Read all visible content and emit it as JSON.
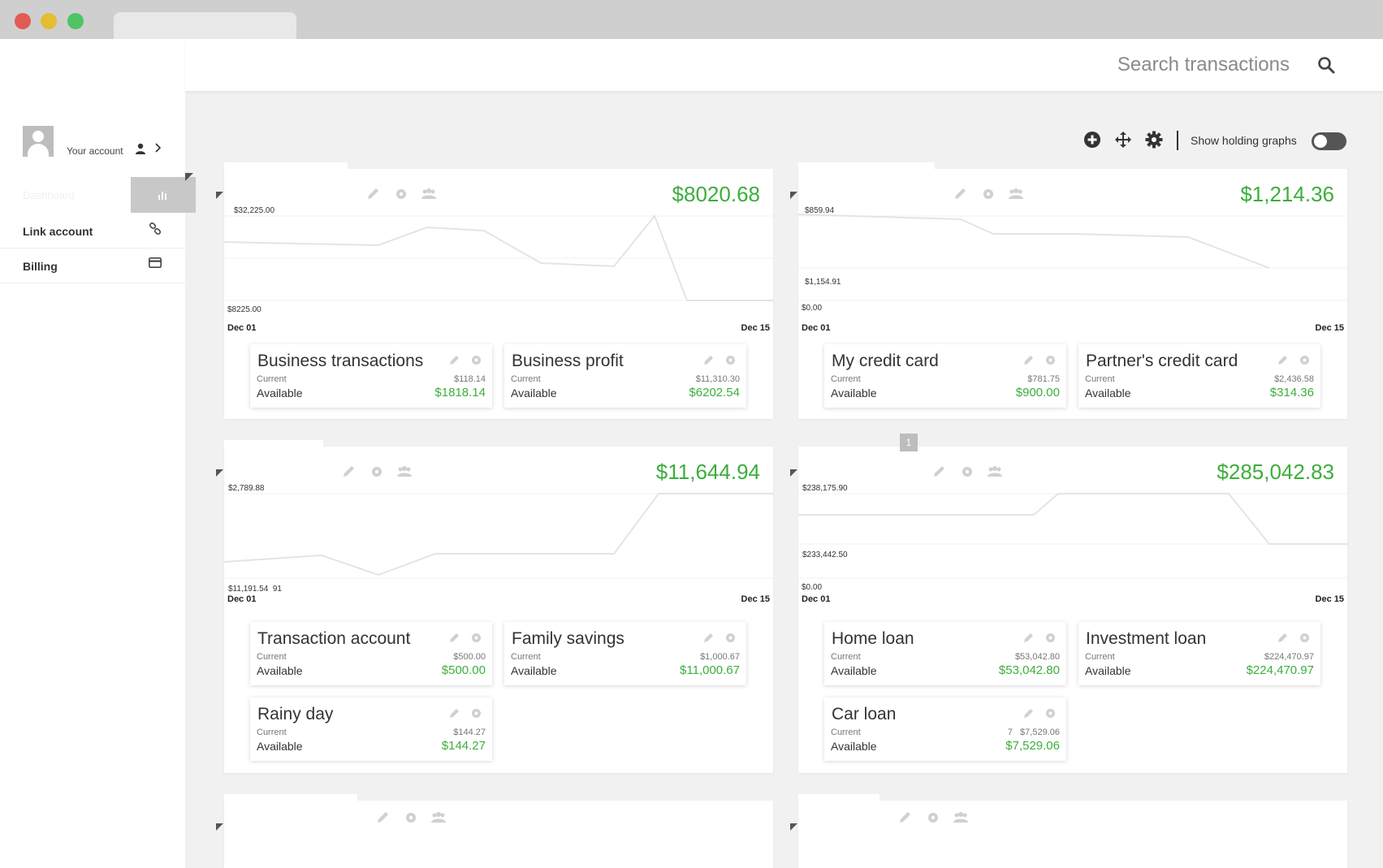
{
  "sidebar": {
    "account_label": "Your account",
    "dashboard_label": "Dashboard",
    "items": [
      {
        "label": "Link account",
        "icon": "link-icon"
      },
      {
        "label": "Billing",
        "icon": "credit-card-icon"
      }
    ]
  },
  "search": {
    "placeholder": "Search transactions"
  },
  "toolbar": {
    "toggle_label": "Show holding graphs",
    "toggle_on": false
  },
  "colors": {
    "positive": "#3cae3c",
    "line": "#e6e6e6"
  },
  "panels": [
    {
      "total": "$8020.68",
      "chart_labels": {
        "top": "$32,225.00",
        "bottom": "$8225.00"
      },
      "dates": {
        "start": "Dec 01",
        "end": "Dec 15"
      },
      "accounts": [
        {
          "name": "Business transactions",
          "current_label": "Current",
          "current": "$118.14",
          "available_label": "Available",
          "available": "$1818.14"
        },
        {
          "name": "Business profit",
          "current_label": "Current",
          "current": "$11,310.30",
          "available_label": "Available",
          "available": "$6202.54"
        }
      ]
    },
    {
      "total": "$1,214.36",
      "chart_labels": {
        "top": "$859.94",
        "mid": "$1,154.91",
        "bottom": "$0.00"
      },
      "dates": {
        "start": "Dec 01",
        "end": "Dec 15"
      },
      "accounts": [
        {
          "name": "My credit card",
          "current_label": "Current",
          "current": "$781.75",
          "available_label": "Available",
          "available": "$900.00"
        },
        {
          "name": "Partner's credit card",
          "current_label": "Current",
          "current": "$2,436.58",
          "available_label": "Available",
          "available": "$314.36"
        }
      ]
    },
    {
      "total": "$11,644.94",
      "chart_labels": {
        "top": "$2,789.88",
        "bottom": "$11,191.54  91"
      },
      "dates": {
        "start": "Dec 01",
        "end": "Dec 15"
      },
      "accounts": [
        {
          "name": "Transaction account",
          "current_label": "Current",
          "current": "$500.00",
          "available_label": "Available",
          "available": "$500.00"
        },
        {
          "name": "Family savings",
          "current_label": "Current",
          "current": "$1,000.67",
          "available_label": "Available",
          "available": "$11,000.67"
        },
        {
          "name": "Rainy day",
          "current_label": "Current",
          "current": "$144.27",
          "available_label": "Available",
          "available": "$144.27"
        }
      ]
    },
    {
      "total": "$285,042.83",
      "badge": "1",
      "chart_labels": {
        "top": "$238,175.90",
        "mid": "$233,442.50",
        "bottom": "$0.00"
      },
      "dates": {
        "start": "Dec 01",
        "end": "Dec 15"
      },
      "accounts": [
        {
          "name": "Home loan",
          "current_label": "Current",
          "current": "$53,042.80",
          "available_label": "Available",
          "available": "$53,042.80"
        },
        {
          "name": "Investment loan",
          "current_label": "Current",
          "current": "$224,470.97",
          "available_label": "Available",
          "available": "$224,470.97"
        },
        {
          "name": "Car loan",
          "current_label": "Current",
          "current": "7   $7,529.06",
          "available_label": "Available",
          "available": "$7,529.06"
        }
      ]
    }
  ]
}
